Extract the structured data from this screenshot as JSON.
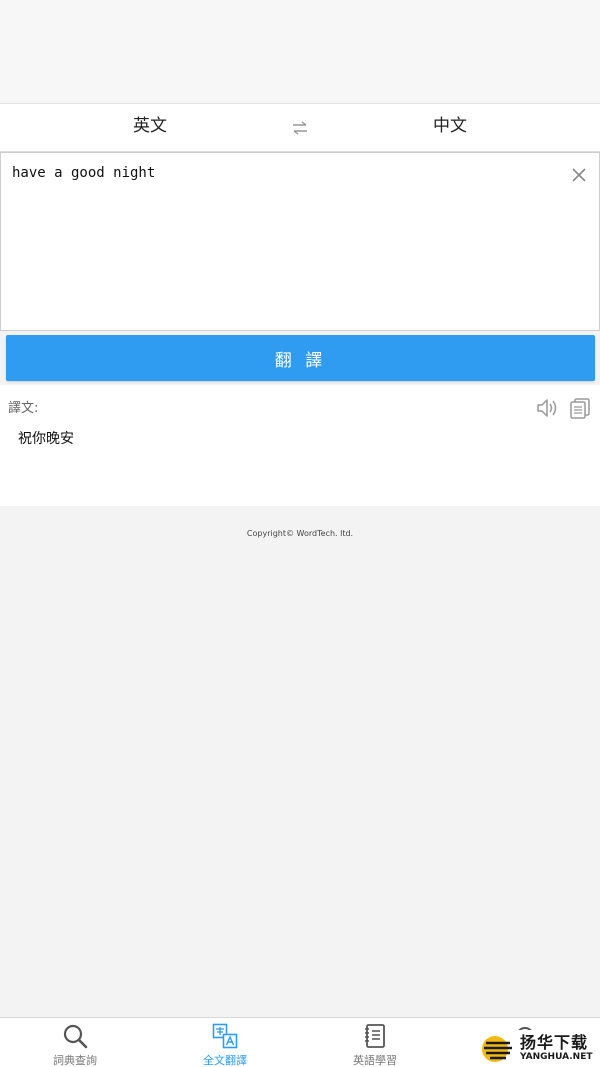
{
  "languages": {
    "source": "英文",
    "target": "中文"
  },
  "input": {
    "value": "have a good night"
  },
  "translate_button": {
    "label": "翻 譯"
  },
  "result": {
    "label": "譯文:",
    "text": "祝你晚安"
  },
  "footer": {
    "copyright": "Copyright© WordTech. ltd."
  },
  "tabs": [
    {
      "label": "詞典查詢",
      "icon": "search-icon"
    },
    {
      "label": "全文翻譯",
      "icon": "translate-icon",
      "active": true
    },
    {
      "label": "英語學習",
      "icon": "notebook-icon"
    },
    {
      "label": "",
      "icon": "gear-icon"
    }
  ],
  "watermark": {
    "cn": "扬华下载",
    "en": "YANGHUA.NET"
  },
  "colors": {
    "accent": "#2f9cf2",
    "background": "#f3f3f3"
  }
}
